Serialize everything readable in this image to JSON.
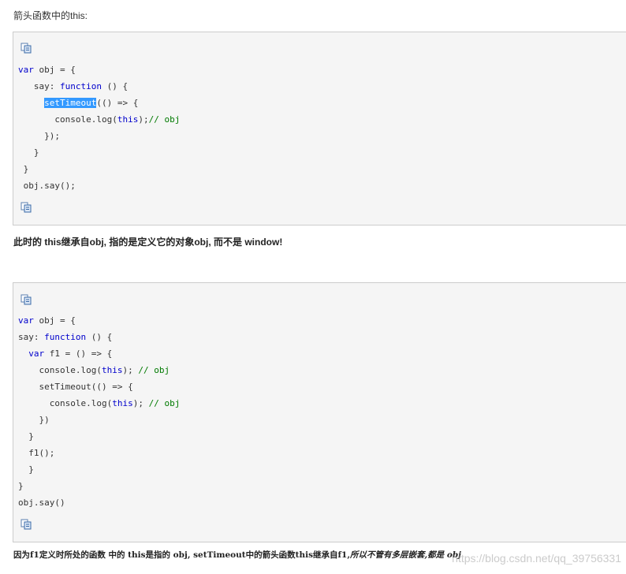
{
  "intro_text": "箭头函数中的this:",
  "icons": {
    "copy": "copy-code-icon"
  },
  "colors": {
    "keyword": "#0000cc",
    "comment": "#007a00",
    "highlight": "#3399ff",
    "code_bg": "#f5f5f5"
  },
  "block1": {
    "lines": [
      [
        "var",
        " obj = {"
      ],
      [
        "   say: ",
        "function",
        " () {"
      ],
      [
        "     ",
        "setTimeout",
        "(() => {"
      ],
      [
        "       console.log(",
        "this",
        ");",
        "// obj"
      ],
      [
        "     });"
      ],
      [
        "   }"
      ],
      [
        " }"
      ],
      [
        " obj.say();"
      ]
    ]
  },
  "note1": "此时的 this继承自obj, 指的是定义它的对象obj, 而不是 window!",
  "block2": {
    "lines": [
      [
        "var",
        " obj = {"
      ],
      [
        "say: ",
        "function",
        " () {"
      ],
      [
        "  ",
        "var",
        " f1 = () => {"
      ],
      [
        "    console.log(",
        "this",
        "); ",
        "// obj"
      ],
      [
        "    setTimeout(() => {"
      ],
      [
        "      console.log(",
        "this",
        "); ",
        "// obj"
      ],
      [
        "    })"
      ],
      [
        "  }"
      ],
      [
        "  f1();"
      ],
      [
        "  }"
      ],
      [
        "}"
      ],
      [
        "obj.say()"
      ]
    ]
  },
  "note2": {
    "bold": "因为f1定义时所处的函数 中的 this是指的 obj, setTimeout中的箭头函数this继承自f1,",
    "italic": "所以不管有多层嵌套,都是 obj"
  },
  "watermark": "https://blog.csdn.net/qq_39756331"
}
